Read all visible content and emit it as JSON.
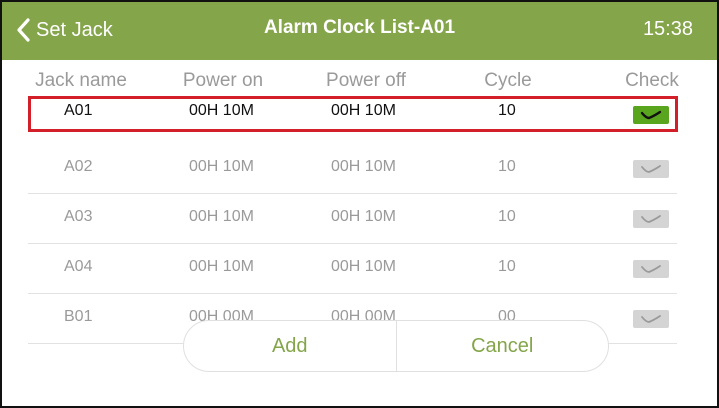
{
  "header": {
    "back_label": "Set Jack",
    "title": "Alarm Clock List-A01",
    "time": "15:38"
  },
  "columns": [
    "Jack name",
    "Power on",
    "Power off",
    "Cycle",
    "Check"
  ],
  "rows": [
    {
      "jack": "A01",
      "power_on": "00H 10M",
      "power_off": "00H 10M",
      "cycle": "10",
      "checked": true
    },
    {
      "jack": "A02",
      "power_on": "00H 10M",
      "power_off": "00H 10M",
      "cycle": "10",
      "checked": false
    },
    {
      "jack": "A03",
      "power_on": "00H 10M",
      "power_off": "00H 10M",
      "cycle": "10",
      "checked": false
    },
    {
      "jack": "A04",
      "power_on": "00H 10M",
      "power_off": "00H 10M",
      "cycle": "10",
      "checked": false
    },
    {
      "jack": "B01",
      "power_on": "00H 00M",
      "power_off": "00H 00M",
      "cycle": "00",
      "checked": false
    }
  ],
  "actions": {
    "add_label": "Add",
    "cancel_label": "Cancel"
  },
  "colors": {
    "header_bg": "#84a54a",
    "accent": "#84a54a",
    "checked": "#5aa51e",
    "unchecked": "#d4d4d4",
    "highlight": "#d21f2a"
  },
  "icons": {
    "back": "chevron-left-icon",
    "check": "checkmark-icon"
  }
}
